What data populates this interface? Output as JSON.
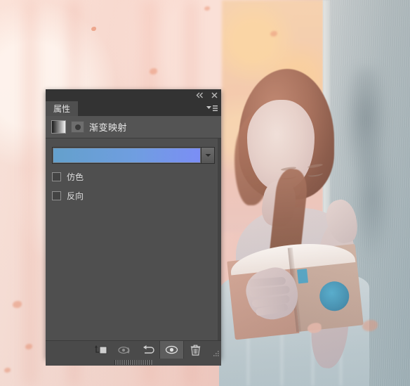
{
  "panel": {
    "titlebar": {
      "collapse_icon": "collapse-double-arrow-icon",
      "close_icon": "close-icon"
    },
    "tab": {
      "label": "属性",
      "menu_icon": "panel-menu-icon"
    },
    "header": {
      "thumbnail_icon": "gradient-thumbnail-icon",
      "badge_icon": "adjustment-dot-icon",
      "title": "渐变映射"
    },
    "gradient": {
      "start_color": "#64a0cc",
      "mid_color": "#6f9ee0",
      "end_color": "#7b8ef5",
      "dropdown_icon": "chevron-down-icon"
    },
    "options": [
      {
        "label": "仿色",
        "checked": false
      },
      {
        "label": "反向",
        "checked": false
      }
    ],
    "footer": {
      "buttons": [
        {
          "name": "clip-to-layer-button",
          "icon": "clip-to-layer-icon",
          "active": false
        },
        {
          "name": "toggle-previous-state-button",
          "icon": "eye-arrow-icon",
          "active": false
        },
        {
          "name": "reset-button",
          "icon": "reset-arrow-icon",
          "active": false
        },
        {
          "name": "toggle-visibility-button",
          "icon": "eye-icon",
          "active": true
        },
        {
          "name": "delete-button",
          "icon": "trash-icon",
          "active": false
        }
      ],
      "resize_grip_icon": "resize-grip-icon",
      "drag_handle_icon": "drag-handle-icon"
    },
    "colors": {
      "titlebar_bg": "#333333",
      "panel_bg": "#4f4f4f",
      "header_bg": "#545454",
      "footer_bg": "#4a4a4a",
      "text": "#dcdcdc"
    }
  },
  "canvas": {
    "description": "photo-of-woman-reading-book-against-wall",
    "background_tone": "#f6cec2",
    "wall_tone": "#a4b3b7"
  }
}
